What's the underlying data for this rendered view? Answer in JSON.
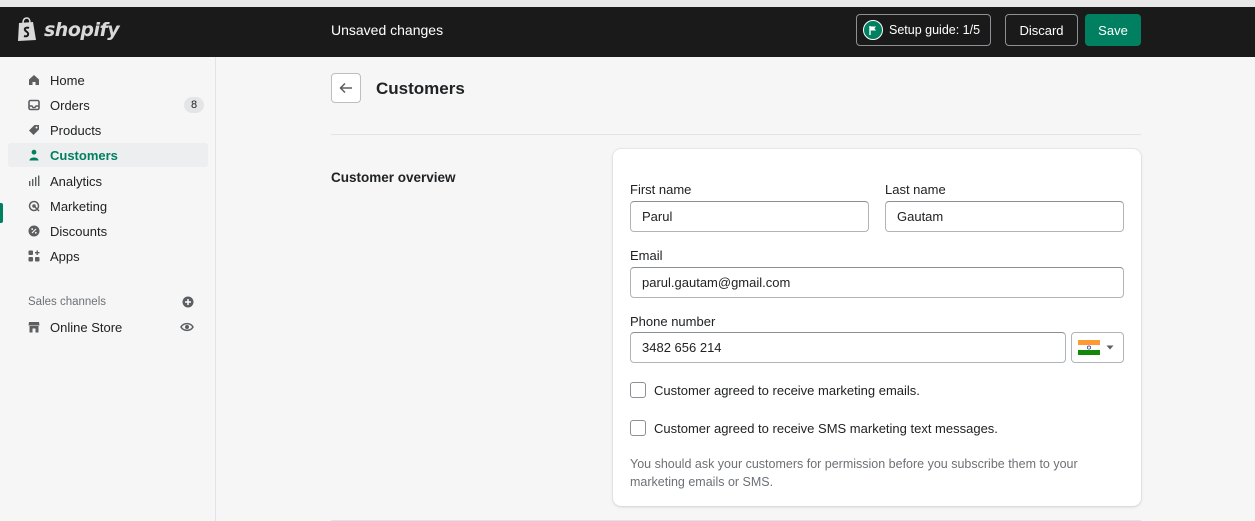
{
  "topbar": {
    "brand": "shopify",
    "status": "Unsaved changes",
    "setup_guide_label": "Setup guide: 1/5",
    "discard_label": "Discard",
    "save_label": "Save"
  },
  "sidebar": {
    "items": [
      {
        "label": "Home",
        "icon": "home-icon"
      },
      {
        "label": "Orders",
        "icon": "orders-icon",
        "badge": "8"
      },
      {
        "label": "Products",
        "icon": "tag-icon"
      },
      {
        "label": "Customers",
        "icon": "person-icon",
        "active": true
      },
      {
        "label": "Analytics",
        "icon": "bar-chart-icon"
      },
      {
        "label": "Marketing",
        "icon": "target-icon"
      },
      {
        "label": "Discounts",
        "icon": "discount-icon"
      },
      {
        "label": "Apps",
        "icon": "apps-icon"
      }
    ],
    "sales_channels_label": "Sales channels",
    "online_store_label": "Online Store"
  },
  "page": {
    "title": "Customers",
    "section_title": "Customer overview"
  },
  "form": {
    "first_name_label": "First name",
    "first_name_value": "Parul",
    "last_name_label": "Last name",
    "last_name_value": "Gautam",
    "email_label": "Email",
    "email_value": "parul.gautam@gmail.com",
    "phone_label": "Phone number",
    "phone_value": "3482 656 214",
    "marketing_email_label": "Customer agreed to receive marketing emails.",
    "marketing_sms_label": "Customer agreed to receive SMS marketing text messages.",
    "help_text": "You should ask your customers for permission before you subscribe them to your marketing emails or SMS."
  },
  "colors": {
    "accent": "#008060",
    "topbar": "#1a1a1a",
    "background": "#f6f6f7"
  }
}
